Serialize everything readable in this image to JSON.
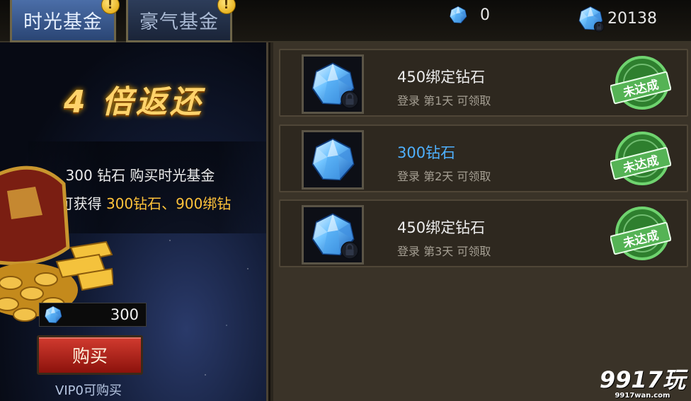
{
  "tabs": [
    {
      "label": "时光基金",
      "active": true,
      "badge": "!"
    },
    {
      "label": "豪气基金",
      "active": false,
      "badge": "!"
    }
  ],
  "currencies": [
    {
      "icon": "blue-diamond-icon",
      "value": "0"
    },
    {
      "icon": "bound-diamond-icon",
      "value": "20138"
    }
  ],
  "promo": {
    "headline": "4 倍返还",
    "line1": "300 钻石 购买时光基金",
    "line2_prefix": "可获得 ",
    "line2_highlight": "300钻石、900绑钻",
    "price": "300",
    "buy_label": "购买",
    "vip_note": "VIP0可购买"
  },
  "rewards": [
    {
      "title": "450绑定钻石",
      "subtitle": "登录 第1天 可领取",
      "status": "未达成",
      "highlight": false
    },
    {
      "title": "300钻石",
      "subtitle": "登录 第2天 可领取",
      "status": "未达成",
      "highlight": true
    },
    {
      "title": "450绑定钻石",
      "subtitle": "登录 第3天 可领取",
      "status": "未达成",
      "highlight": false
    }
  ],
  "watermark": {
    "main": "9917玩",
    "sub": "9917wan.com"
  },
  "colors": {
    "accent_gold": "#ffc23a",
    "highlight_blue": "#4fb1ff",
    "stamp_green": "#3aa63a"
  }
}
